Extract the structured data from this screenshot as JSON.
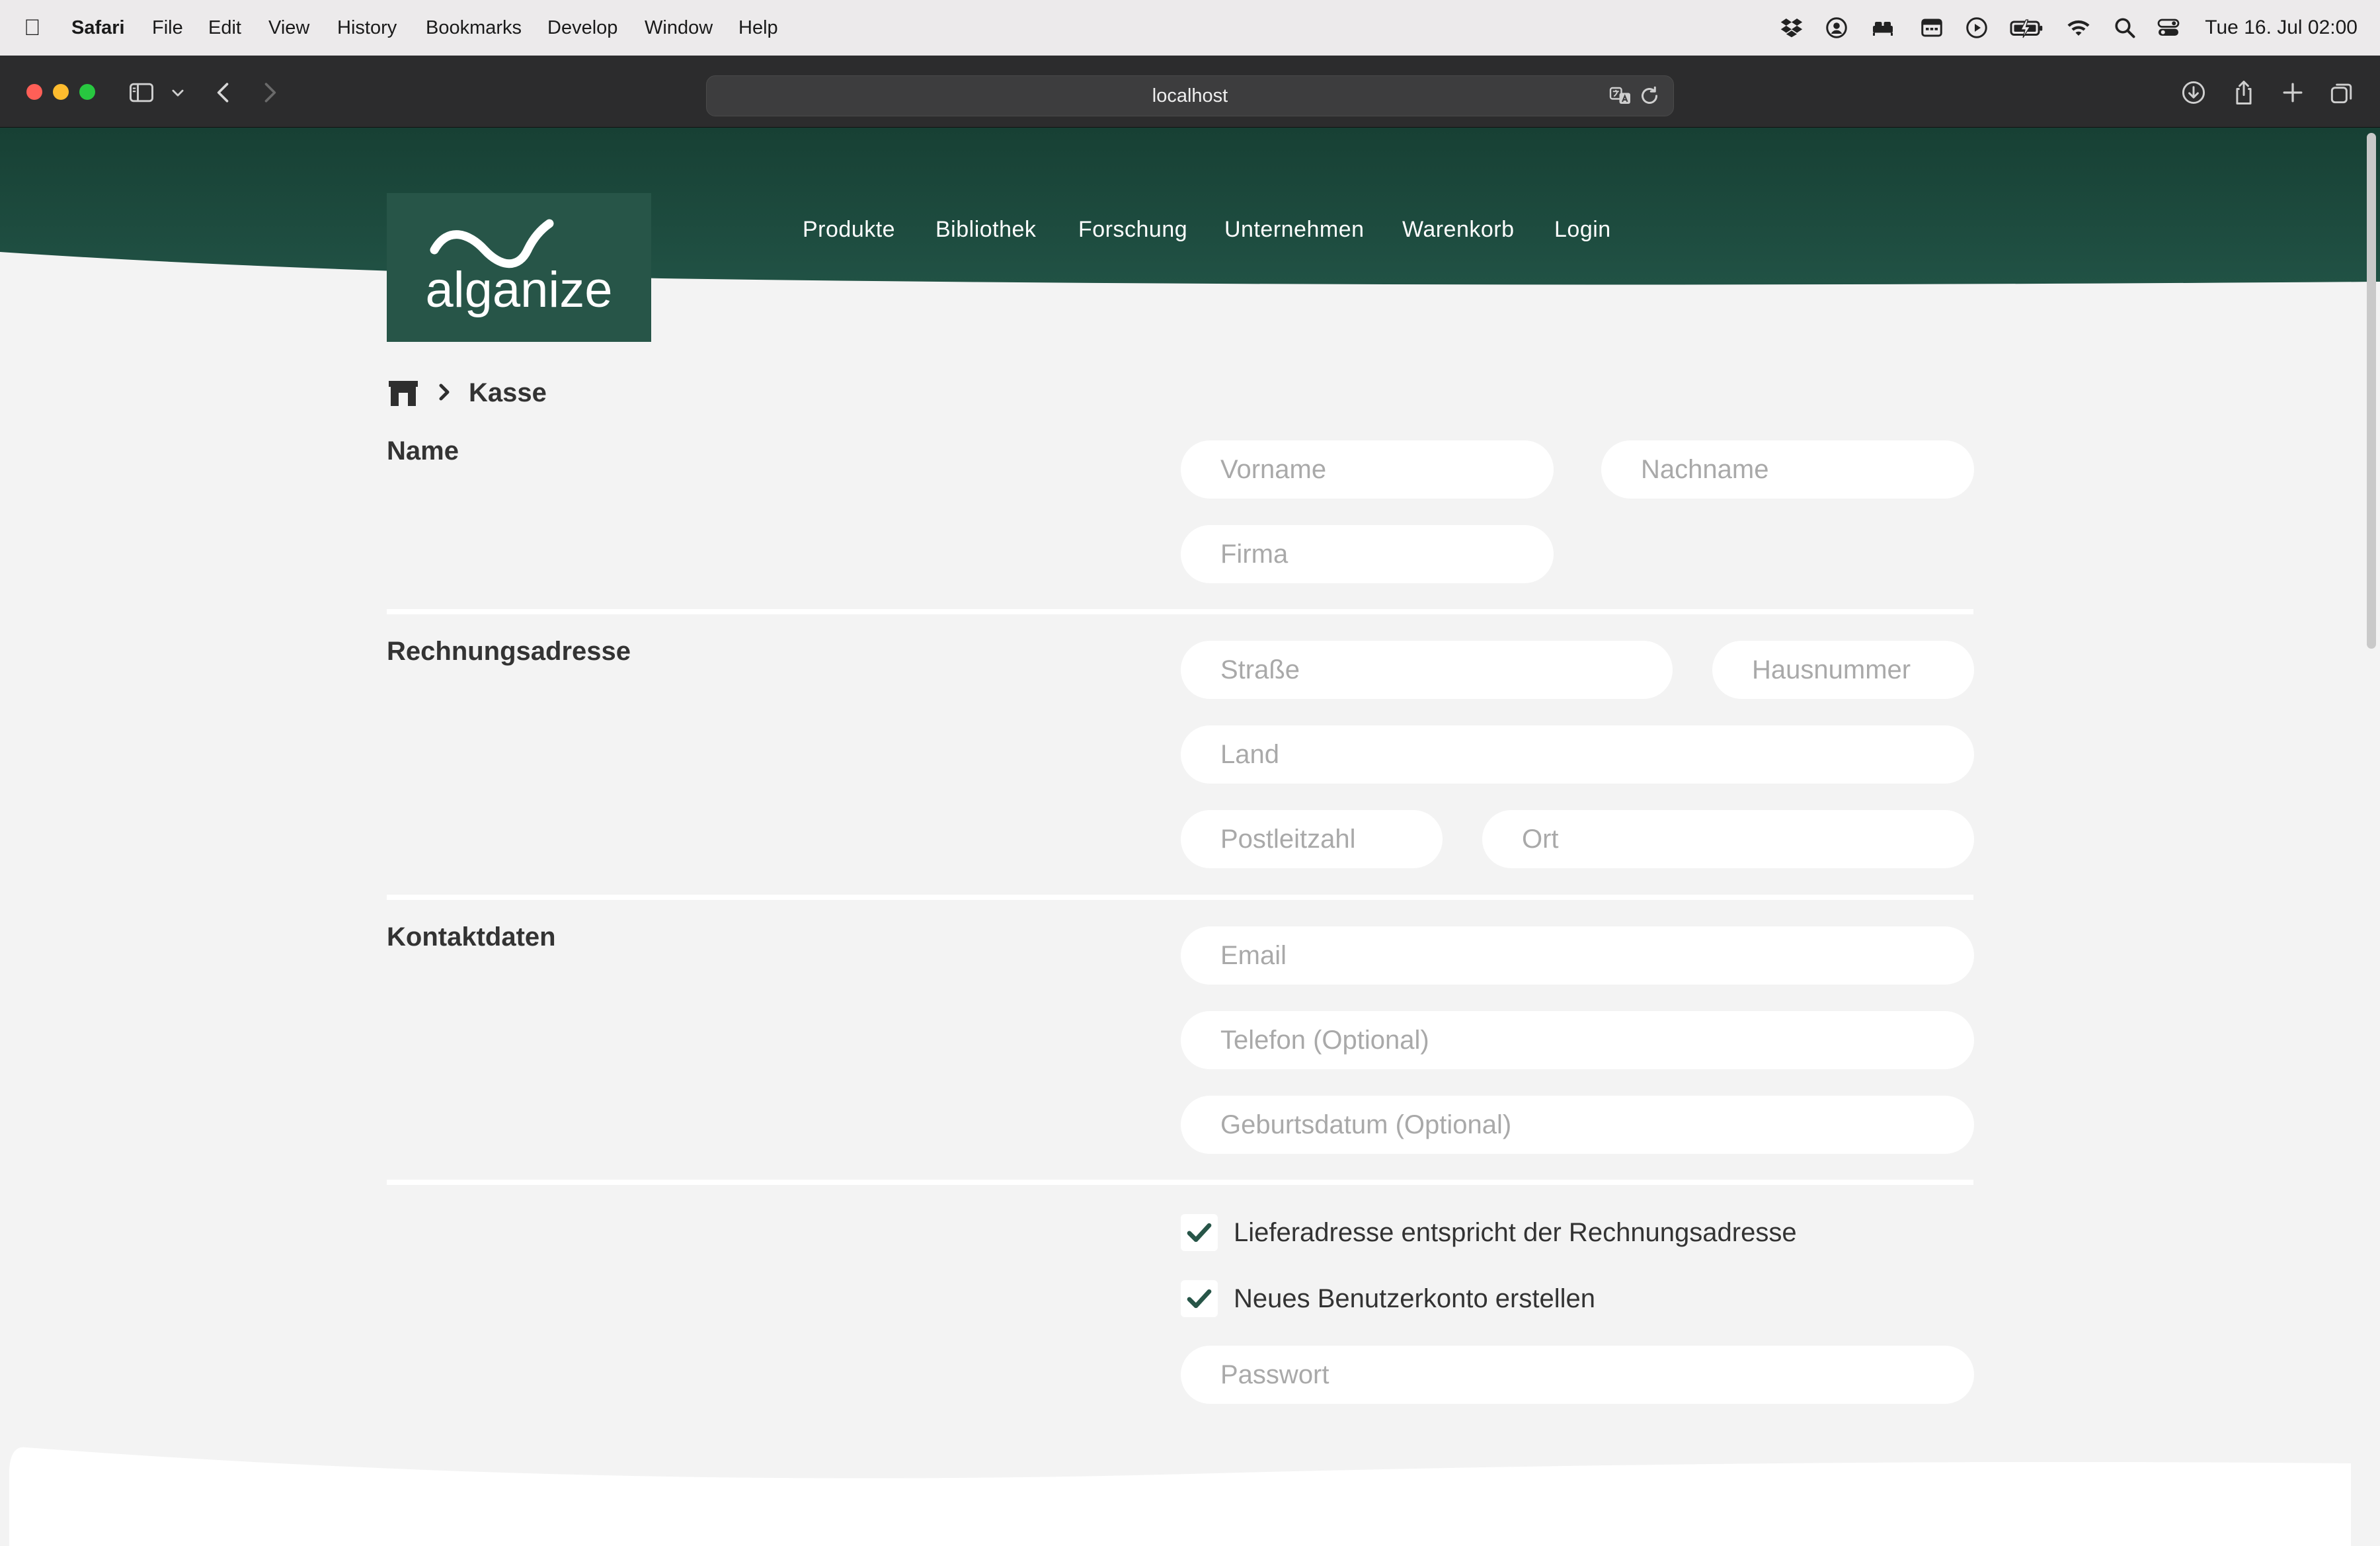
{
  "menubar": {
    "app": "Safari",
    "items": [
      "File",
      "Edit",
      "View",
      "History",
      "Bookmarks",
      "Develop",
      "Window",
      "Help"
    ],
    "clock": "Tue 16. Jul  02:00"
  },
  "browser": {
    "url": "localhost"
  },
  "site": {
    "logo_text": "alganize",
    "nav": [
      "Produkte",
      "Bibliothek",
      "Forschung",
      "Unternehmen",
      "Warenkorb",
      "Login"
    ],
    "breadcrumb": {
      "current": "Kasse"
    },
    "colors": {
      "brand": "#275548",
      "header": "#1e4b3f",
      "background": "#f3f3f3"
    }
  },
  "form": {
    "name": {
      "label": "Name",
      "first_name_placeholder": "Vorname",
      "last_name_placeholder": "Nachname",
      "company_placeholder": "Firma"
    },
    "billing": {
      "label": "Rechnungsadresse",
      "street_placeholder": "Straße",
      "house_number_placeholder": "Hausnummer",
      "country_placeholder": "Land",
      "zip_placeholder": "Postleitzahl",
      "city_placeholder": "Ort"
    },
    "contact": {
      "label": "Kontaktdaten",
      "email_placeholder": "Email",
      "phone_placeholder": "Telefon (Optional)",
      "birthday_placeholder": "Geburtsdatum (Optional)"
    },
    "options": {
      "same_address_label": "Lieferadresse entspricht der Rechnungsadresse",
      "same_address_checked": true,
      "create_account_label": "Neues Benutzerkonto erstellen",
      "create_account_checked": true,
      "password_placeholder": "Passwort"
    }
  }
}
